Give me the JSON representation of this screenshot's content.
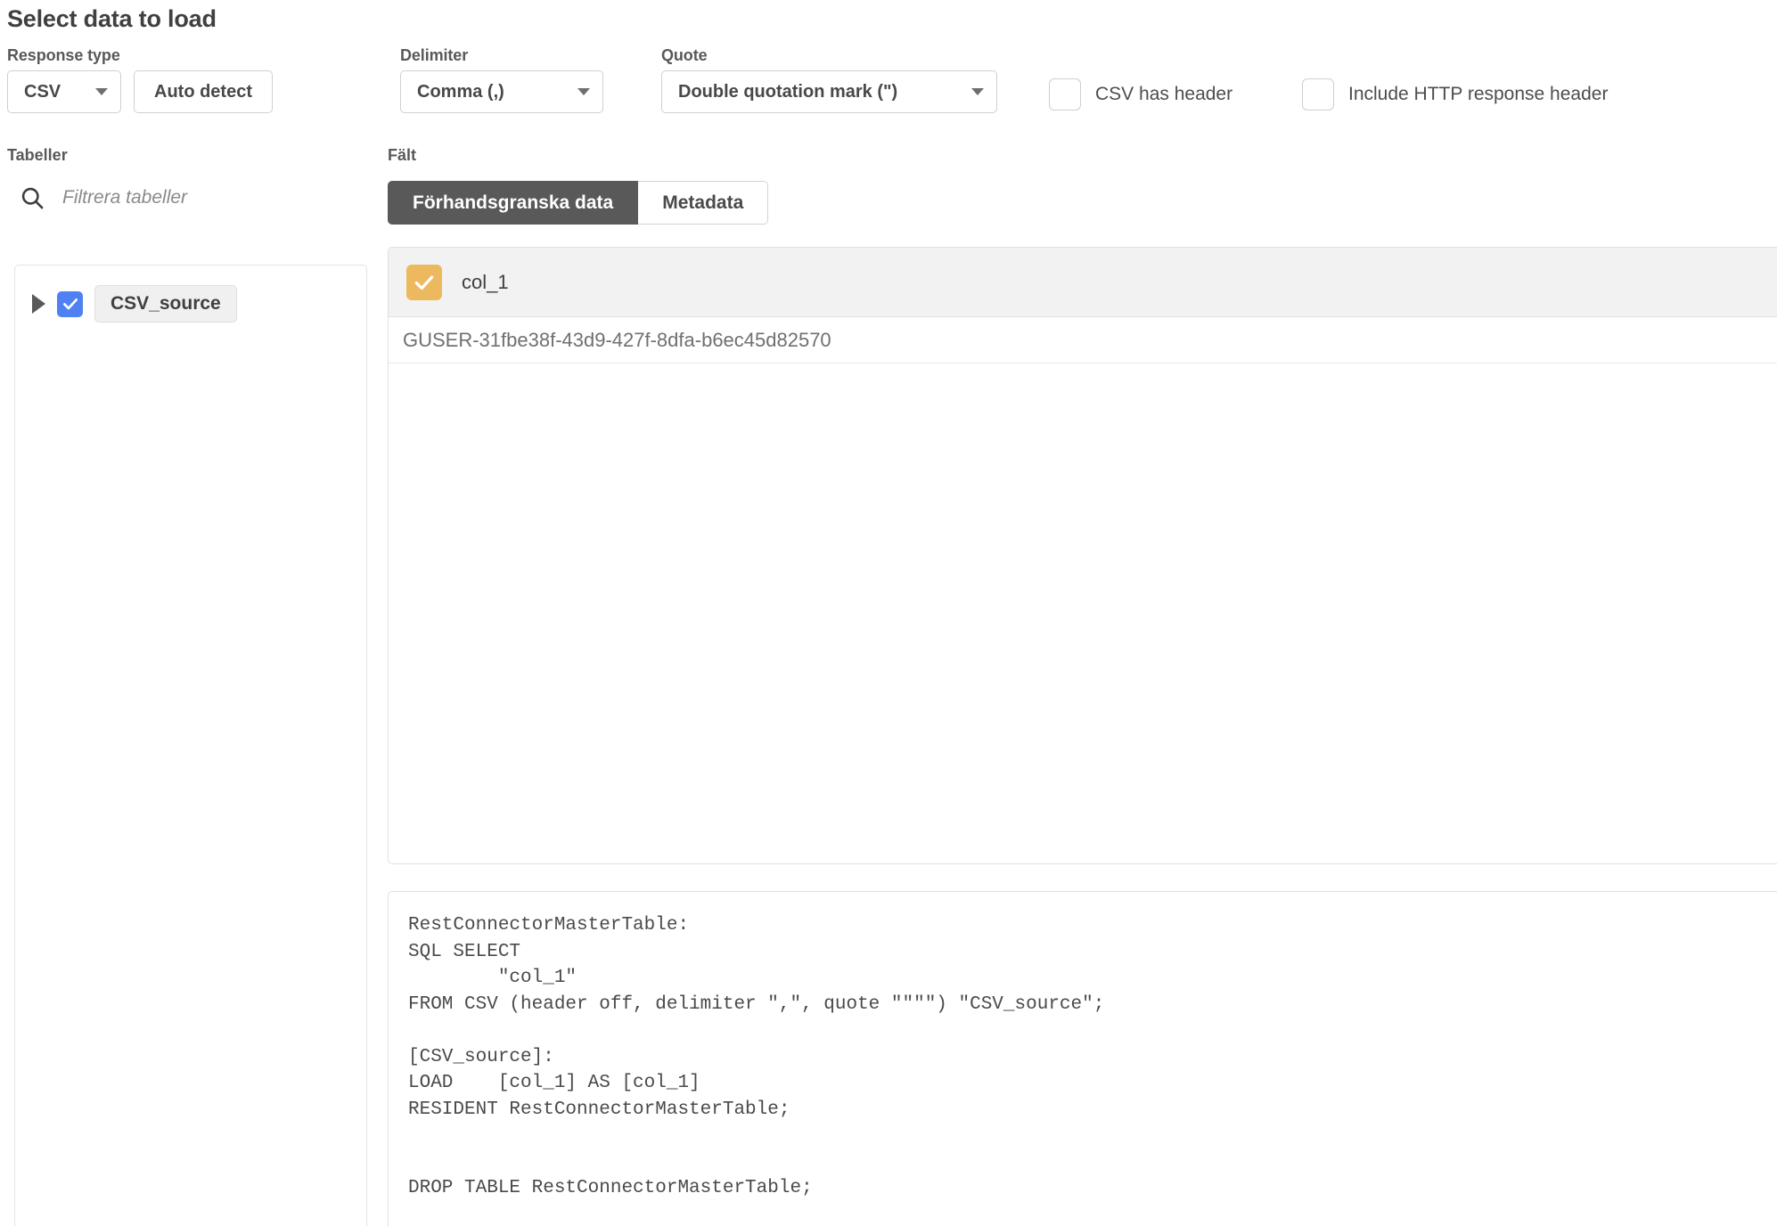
{
  "page_title": "Select data to load",
  "options": {
    "response_type": {
      "label": "Response type",
      "value": "CSV",
      "auto_detect_label": "Auto detect"
    },
    "delimiter": {
      "label": "Delimiter",
      "value": "Comma (,)"
    },
    "quote": {
      "label": "Quote",
      "value": "Double quotation mark (\")"
    },
    "csv_has_header": {
      "label": "CSV has header",
      "checked": false
    },
    "include_http_response_header": {
      "label": "Include HTTP response header",
      "checked": false
    }
  },
  "tables": {
    "heading": "Tabeller",
    "filter_placeholder": "Filtrera tabeller",
    "filter_value": "",
    "items": [
      {
        "name": "CSV_source",
        "checked": true,
        "expanded": false
      }
    ]
  },
  "fields": {
    "heading": "Fält",
    "tabs": [
      {
        "label": "Förhandsgranska data",
        "active": true
      },
      {
        "label": "Metadata",
        "active": false
      }
    ],
    "columns": [
      {
        "name": "col_1",
        "checked": true
      }
    ],
    "rows": [
      {
        "col_1": "GUSER-31fbe38f-43d9-427f-8dfa-b6ec45d82570"
      }
    ]
  },
  "script": {
    "text": "RestConnectorMasterTable:\nSQL SELECT\n        \"col_1\"\nFROM CSV (header off, delimiter \",\", quote \"\"\"\") \"CSV_source\";\n\n[CSV_source]:\nLOAD    [col_1] AS [col_1]\nRESIDENT RestConnectorMasterTable;\n\n\nDROP TABLE RestConnectorMasterTable;"
  },
  "colors": {
    "checkbox_blue": "#4f81f2",
    "checkbox_amber": "#edb95e",
    "tab_active_bg": "#595959"
  }
}
